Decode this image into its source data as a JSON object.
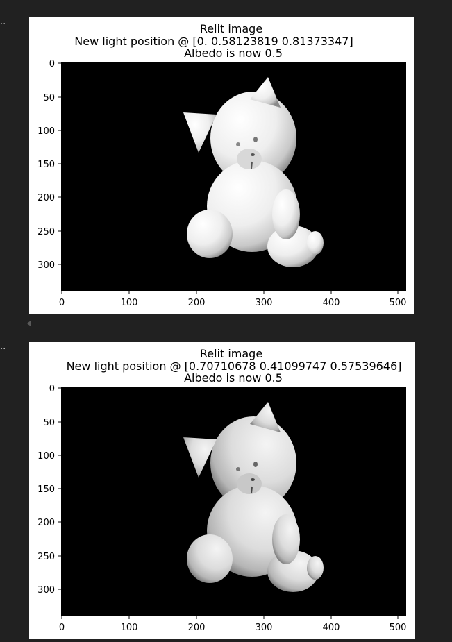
{
  "cells": [
    {
      "prompt": "..",
      "title_lines": [
        "Relit image",
        "New light position @ [0.         0.58123819 0.81373347]",
        "Albedo is now 0.5"
      ],
      "x_ticks": [
        "0",
        "100",
        "200",
        "300",
        "400",
        "500"
      ],
      "y_ticks": [
        "0",
        "50",
        "100",
        "150",
        "200",
        "250",
        "300"
      ],
      "image_content": "white cat figurine relit on black background"
    },
    {
      "prompt": "..",
      "title_lines": [
        "Relit image",
        "New light position @ [0.70710678 0.41099747 0.57539646]",
        "Albedo is now 0.5"
      ],
      "x_ticks": [
        "0",
        "100",
        "200",
        "300",
        "400",
        "500"
      ],
      "y_ticks": [
        "0",
        "50",
        "100",
        "150",
        "200",
        "250",
        "300"
      ],
      "image_content": "white cat figurine relit on black background"
    }
  ]
}
